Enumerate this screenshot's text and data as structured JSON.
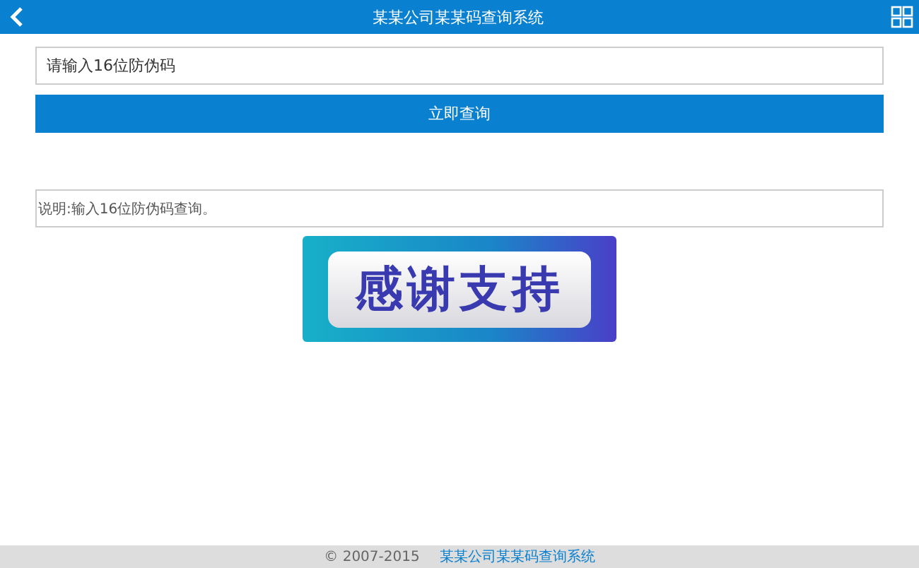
{
  "header": {
    "title": "某某公司某某码查询系统"
  },
  "search": {
    "placeholder": "请输入16位防伪码"
  },
  "query_button": "立即查询",
  "note": "说明:输入16位防伪码查询。",
  "banner": {
    "text": "感谢支持"
  },
  "footer": {
    "copyright": "© 2007-2015",
    "link": "某某公司某某码查询系统"
  }
}
